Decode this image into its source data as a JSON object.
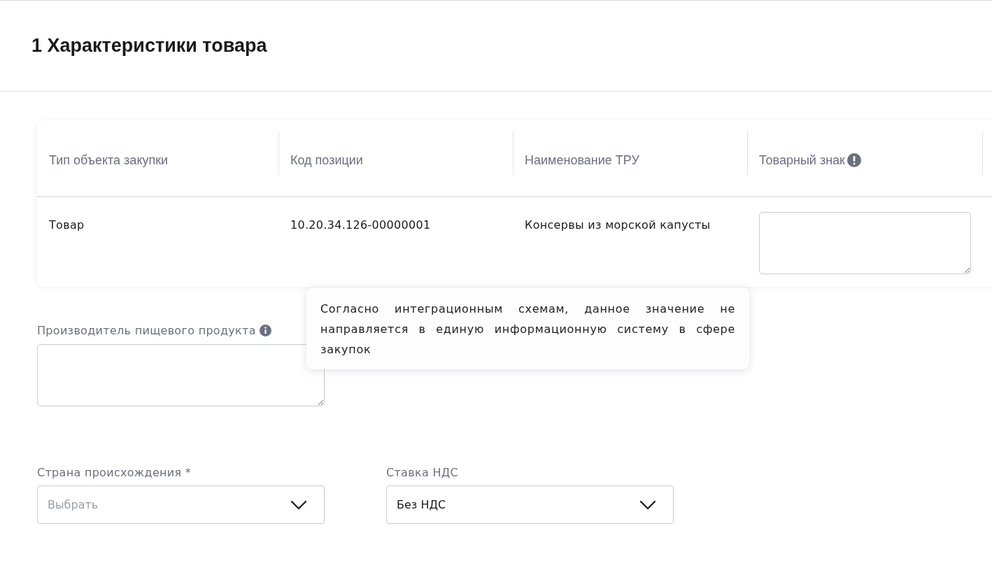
{
  "section": {
    "title": "1 Характеристики товара"
  },
  "table": {
    "columns": [
      {
        "label": "Тип объекта закупки",
        "kind": "text"
      },
      {
        "label": "Код позиции",
        "kind": "text"
      },
      {
        "label": "Наименование ТРУ",
        "kind": "text"
      },
      {
        "label": "Товарный знак",
        "kind": "field"
      }
    ],
    "rows": [
      {
        "cells": [
          "Товар",
          "10.20.34.126-00000001",
          "Консервы из морской капусты"
        ]
      }
    ]
  },
  "tooltip": {
    "text": "Согласно интеграционным схемам, данное значение не направляется в единую информационную систему в сфере закупок"
  },
  "producer": {
    "label": "Производитель пищевого продукта"
  },
  "selects": [
    {
      "label": "Страна происхождения *",
      "placeholder": "Выбрать"
    },
    {
      "label": "Ставка НДС",
      "value": "Без НДС"
    }
  ]
}
